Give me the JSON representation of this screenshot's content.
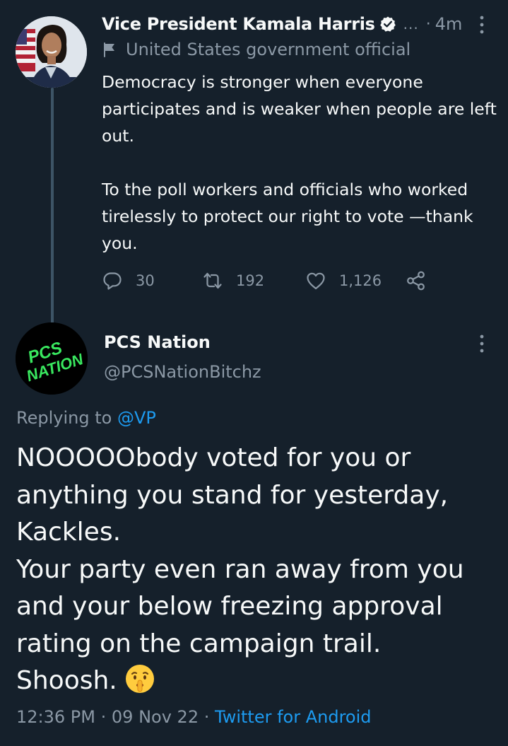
{
  "tweet": {
    "author_name": "Vice President Kamala Harris",
    "name_ellipsis": "...",
    "separator": "·",
    "time_ago": "4m",
    "label": "United States government official",
    "paragraph_1": "Democracy is stronger when everyone participates and is weaker when people are left out.",
    "paragraph_2": "To the poll workers and officials who worked tirelessly to protect our right to vote —thank you.",
    "reply_count": "30",
    "retweet_count": "192",
    "like_count": "1,126"
  },
  "reply": {
    "author_name": "PCS Nation",
    "handle": "@PCSNationBitchz",
    "replying_prefix": "Replying to",
    "replying_to": "@VP",
    "lines": [
      "NOOOOObody voted for you or",
      "anything you stand for yesterday,",
      "Kackles.",
      "Your party even ran away from you",
      "and your below freezing approval",
      "rating on the campaign trail.",
      "Shoosh."
    ],
    "emoji": "🤫",
    "avatar_text_line1": "PCS",
    "avatar_text_line2": "NATION",
    "footer_time": "12:36 PM",
    "footer_sep": "·",
    "footer_date": "09 Nov 22",
    "footer_source": "Twitter for Android"
  },
  "colors": {
    "background": "#15202b",
    "primary_text": "#f7f9f9",
    "secondary_text": "#8b98a5",
    "link": "#1d9bf0",
    "thread_line": "#3d5466",
    "pcs_green": "#39e75f"
  },
  "icons": {
    "verified": "verified-badge-icon",
    "label": "flag-icon",
    "more": "more-vertical-icon",
    "reply": "reply-icon",
    "retweet": "retweet-icon",
    "like": "heart-icon",
    "share": "share-icon"
  }
}
